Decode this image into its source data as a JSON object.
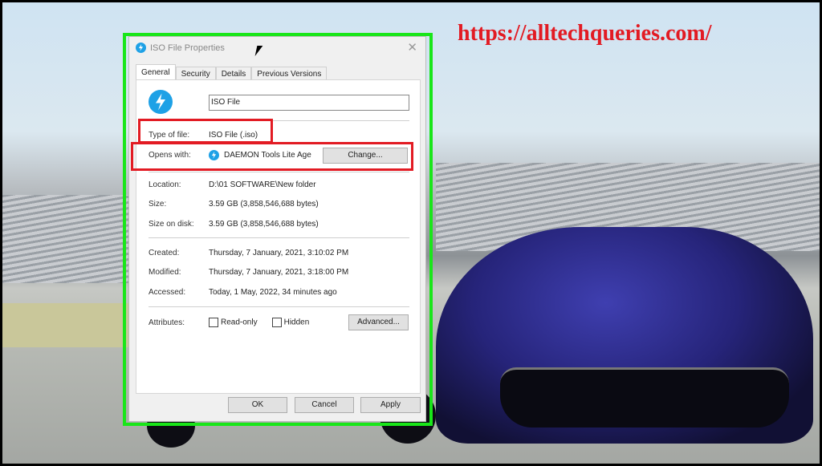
{
  "watermark": "https://alltechqueries.com/",
  "dialog": {
    "title": "ISO File Properties",
    "tabs": [
      {
        "label": "General",
        "active": true
      },
      {
        "label": "Security"
      },
      {
        "label": "Details"
      },
      {
        "label": "Previous Versions"
      }
    ],
    "file_name": "ISO File",
    "type_of_file": {
      "label": "Type of file:",
      "value": "ISO File (.iso)"
    },
    "opens_with": {
      "label": "Opens with:",
      "value": "DAEMON Tools Lite Age",
      "change_label": "Change..."
    },
    "location": {
      "label": "Location:",
      "value": "D:\\01 SOFTWARE\\New folder"
    },
    "size": {
      "label": "Size:",
      "value": "3.59 GB (3,858,546,688 bytes)"
    },
    "size_on_disk": {
      "label": "Size on disk:",
      "value": "3.59 GB (3,858,546,688 bytes)"
    },
    "created": {
      "label": "Created:",
      "value": "Thursday, 7 January, 2021, 3:10:02 PM"
    },
    "modified": {
      "label": "Modified:",
      "value": "Thursday, 7 January, 2021, 3:18:00 PM"
    },
    "accessed": {
      "label": "Accessed:",
      "value": "Today, 1 May, 2022, 34 minutes ago"
    },
    "attributes": {
      "label": "Attributes:",
      "read_only": "Read-only",
      "read_only_checked": false,
      "hidden": "Hidden",
      "hidden_checked": false,
      "advanced_label": "Advanced..."
    },
    "buttons": {
      "ok": "OK",
      "cancel": "Cancel",
      "apply": "Apply"
    }
  },
  "colors": {
    "highlight_green": "#19e619",
    "highlight_red": "#e21b23",
    "daemon_icon": "#1ea1e6"
  }
}
